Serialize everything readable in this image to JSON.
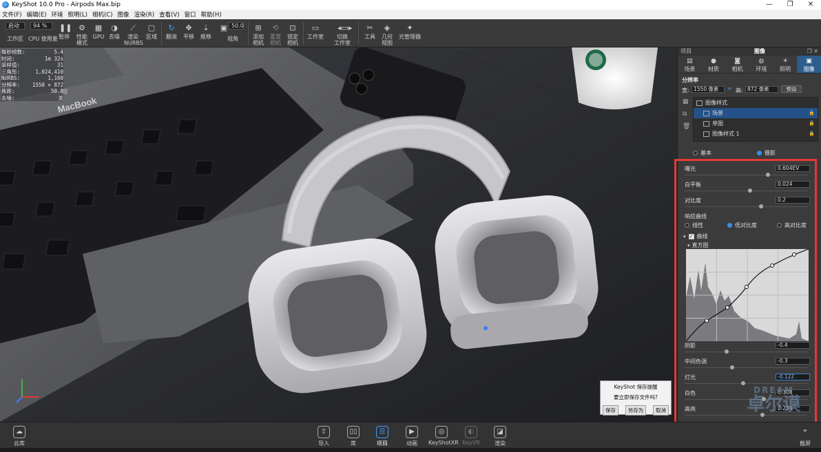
{
  "window": {
    "title": "KeyShot 10.0 Pro  -  Airpods Max.bip",
    "min": "—",
    "max": "❐",
    "close": "✕"
  },
  "menu": [
    "文件(F)",
    "编辑(E)",
    "环境",
    "照明(L)",
    "相机(C)",
    "图像",
    "渲染(R)",
    "查看(V)",
    "窗口",
    "帮助(H)"
  ],
  "toolbar": {
    "start_value": "启动",
    "percent_value": "94 %",
    "workspace": "工作区",
    "cpu": "CPU 使用量",
    "pause": "暂停",
    "perf_mode": "性能\n模式",
    "gpu": "GPU",
    "denoise": "去噪",
    "render_nurbs": "渲染\nNURBS",
    "region": "区域",
    "tumble": "翻滚",
    "pan": "平移",
    "dolly": "推移",
    "fov_value": "50.0",
    "fov": "视角",
    "add_camera": "添加\n相机",
    "reset_camera": "重置\n相机",
    "lock_camera": "锁定\n相机",
    "studio": "工作室",
    "switch_studio": "切换\n工作室",
    "tools": "工具",
    "geometry_view": "几何\n视图",
    "light_manager": "光管理器"
  },
  "stats": [
    {
      "k": "每秒帧数:",
      "v": "5.4"
    },
    {
      "k": "时间:",
      "v": "1m 32s"
    },
    {
      "k": "采样值:",
      "v": "31"
    },
    {
      "k": "三角形:",
      "v": "1,024,410"
    },
    {
      "k": "NURBS:",
      "v": "1,160"
    },
    {
      "k": "分辨率:",
      "v": "1550 × 872"
    },
    {
      "k": "焦距:",
      "v": "50.0"
    },
    {
      "k": "去噪:",
      "v": "关"
    }
  ],
  "scene_text": {
    "laptop_brand": "MacBook"
  },
  "panel": {
    "left_title": "项目",
    "title": "图像",
    "tabs": [
      "场景",
      "材质",
      "相机",
      "环境",
      "照明",
      "图像"
    ],
    "resolution_title": "分辨率",
    "width_label": "宽:",
    "width_value": "1550 像素",
    "height_label": "高:",
    "height_value": "872 像素",
    "preset_btn": "预设",
    "layers": [
      "图像样式",
      "场景",
      "单图",
      "图像样式 1"
    ],
    "mode_basic": "基本",
    "mode_photo": "摄影",
    "exposure_label": "曝光",
    "exposure_value": "0.604EV",
    "wb_label": "白平衡",
    "wb_value": "0.024",
    "contrast_label": "对比度",
    "contrast_value": "0.2",
    "response_label": "响应曲线",
    "curve_linear": "线性",
    "curve_low": "低对比度",
    "curve_high": "高对比度",
    "curve_section": "曲线",
    "histogram_label": "直方图",
    "shadows_label": "阴影",
    "shadows_value": "-0.4",
    "midtones_label": "中间色调",
    "midtones_value": "-0.3",
    "lights_label": "灯光",
    "lights_value": "-0.122",
    "whites_label": "白色",
    "whites_value": "0.308",
    "highlights_label": "高亮",
    "highlights_value": "0.234"
  },
  "save_dialog": {
    "title": "KeyShot 保存提醒",
    "message": "要立即保存文件吗?",
    "save": "保存",
    "save_as": "另存为",
    "cancel": "取消"
  },
  "watermark": {
    "line1": "DREAM",
    "line2": "卓尔谟"
  },
  "bottom": {
    "cloud": "云库",
    "import": "导入",
    "library": "库",
    "project": "项目",
    "animation": "动画",
    "keyshotxr": "KeyShotXR",
    "keyvr": "KeyVR",
    "render": "渲染",
    "screenshot": "截屏"
  },
  "colors": {
    "accent": "#3ca3ff",
    "highlight_box": "#e53935",
    "panel_selected": "#24518a"
  }
}
